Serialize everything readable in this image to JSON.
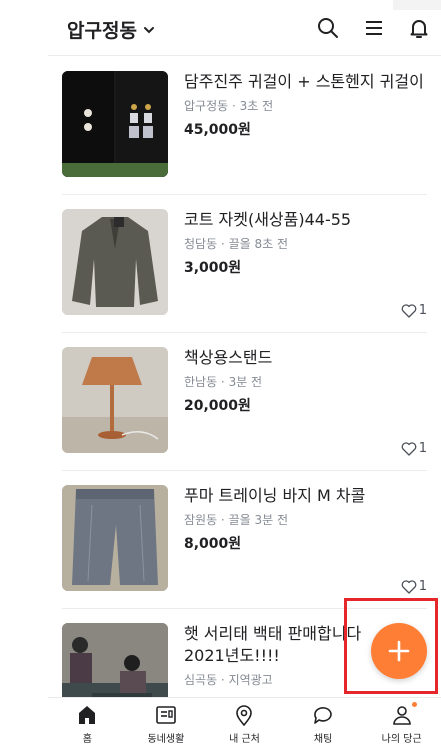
{
  "header": {
    "location": "압구정동"
  },
  "items": [
    {
      "title": "담주진주 귀걸이 + 스톤헨지 귀걸이",
      "meta": "압구정동 · 3초 전",
      "price": "45,000원",
      "likes": ""
    },
    {
      "title": "코트 자켓(새상품)44-55",
      "meta": "청담동 · 끌올 8초 전",
      "price": "3,000원",
      "likes": "1"
    },
    {
      "title": "책상용스탠드",
      "meta": "한남동 · 3분 전",
      "price": "20,000원",
      "likes": "1"
    },
    {
      "title": "푸마 트레이닝 바지 M 차콜",
      "meta": "잠원동 · 끌올 3분 전",
      "price": "8,000원",
      "likes": "1"
    },
    {
      "title": "햇 서리태 백태 판매합니다 2021년도!!!!",
      "meta": "심곡동 · 지역광고",
      "price": "",
      "likes": ""
    }
  ],
  "tabs": [
    {
      "label": "홈"
    },
    {
      "label": "동네생활"
    },
    {
      "label": "내 근처"
    },
    {
      "label": "채팅"
    },
    {
      "label": "나의 당근"
    }
  ],
  "colors": {
    "accent": "#ff7e36",
    "highlight_box": "#e5262b"
  }
}
